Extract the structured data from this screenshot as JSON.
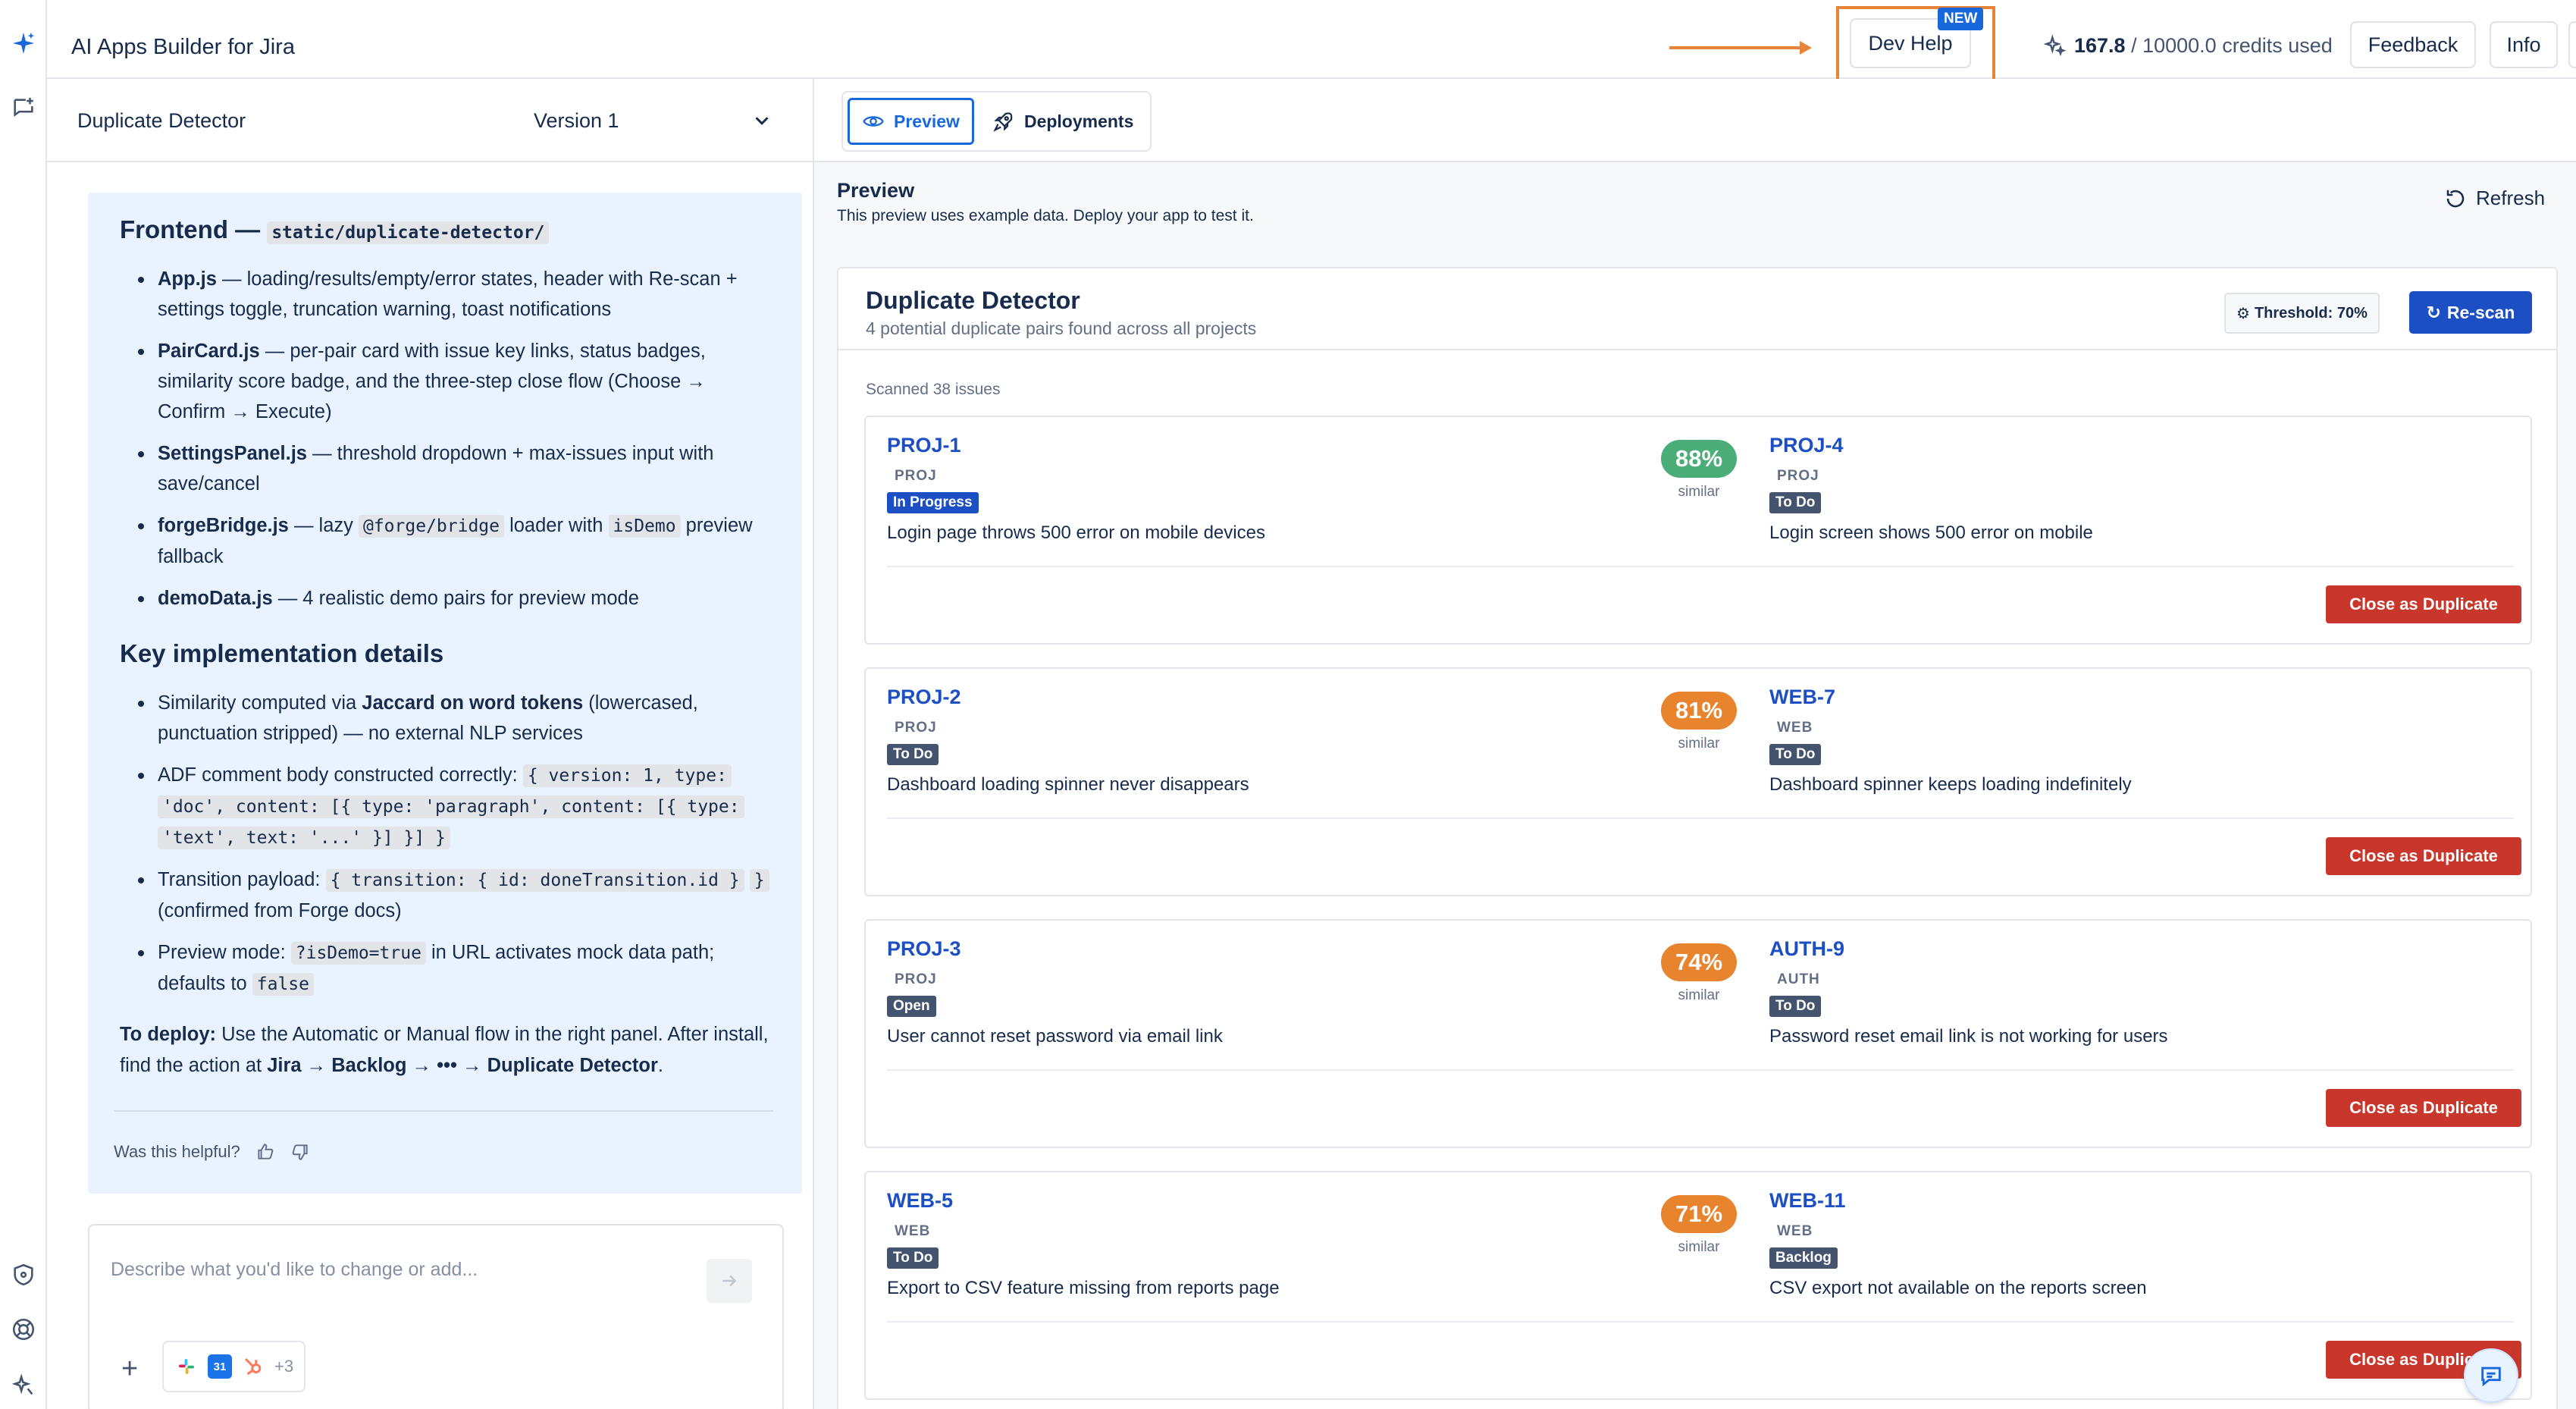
{
  "app": {
    "title": "AI Apps Builder for Jira"
  },
  "topbar": {
    "dev_help": "Dev Help",
    "new_badge": "NEW",
    "credits_used": "167.8",
    "credits_rest": "/ 10000.0 credits used",
    "feedback": "Feedback",
    "info": "Info",
    "more": "•••",
    "accent_color": "#e8833a"
  },
  "rail": {
    "icons": [
      "sparkle-icon",
      "chat-add-icon",
      "shield-icon",
      "help-circle-icon",
      "sparkle-settings-icon"
    ]
  },
  "left": {
    "app_name": "Duplicate Detector",
    "version": "Version 1",
    "frontend_heading": "Frontend —",
    "frontend_path": "static/duplicate-detector/",
    "frontend_items": [
      {
        "name": "App.js",
        "text": " — loading/results/empty/error states, header with Re-scan + settings toggle, truncation warning, toast notifications"
      },
      {
        "name": "PairCard.js",
        "text": " — per-pair card with issue key links, status badges, similarity score badge, and the three-step close flow (Choose → Confirm → Execute)"
      },
      {
        "name": "SettingsPanel.js",
        "text": " — threshold dropdown + max-issues input with save/cancel"
      },
      {
        "name": "forgeBridge.js",
        "text_a": " — lazy ",
        "code_a": "@forge/bridge",
        "text_b": " loader with ",
        "code_b": "isDemo",
        "text_c": " preview fallback"
      },
      {
        "name": "demoData.js",
        "text": " — 4 realistic demo pairs for preview mode"
      }
    ],
    "impl_heading": "Key implementation details",
    "impl_1_a": "Similarity computed via ",
    "impl_1_b": "Jaccard on word tokens",
    "impl_1_c": " (lowercased, punctuation stripped) — no external NLP services",
    "impl_2_a": "ADF comment body constructed correctly: ",
    "impl_2_code_1": "{ version: 1, type:",
    "impl_2_code_2": "'doc', content: [{ type: 'paragraph', content: [{ type:",
    "impl_2_code_3": "'text', text: '...' }] }] }",
    "impl_3_a": "Transition payload: ",
    "impl_3_code_1": "{ transition: { id: doneTransition.id }",
    "impl_3_code_2": "}",
    "impl_3_b": " (confirmed from Forge docs)",
    "impl_4_a": "Preview mode: ",
    "impl_4_code": "?isDemo=true",
    "impl_4_b": " in URL activates mock data path; defaults to ",
    "impl_4_code_2": "false",
    "deploy_label": "To deploy:",
    "deploy_text_a": " Use the Automatic or Manual flow in the right panel. After install, find the action at ",
    "deploy_path": "Jira → Backlog → ••• → Duplicate Detector",
    "deploy_end": ".",
    "helpful": "Was this helpful?",
    "prompt_placeholder": "Describe what you'd like to change or add...",
    "integrations_more": "+3"
  },
  "preview": {
    "tab_preview": "Preview",
    "tab_deployments": "Deployments",
    "title": "Preview",
    "subtitle": "This preview uses example data. Deploy your app to test it.",
    "refresh": "Refresh",
    "card_title": "Duplicate Detector",
    "card_sub": "4 potential duplicate pairs found across all projects",
    "threshold": "Threshold: 70%",
    "rescan": "Re-scan",
    "scanned": "Scanned 38 issues",
    "similar_label": "similar",
    "close_label": "Close as Duplicate",
    "pairs": [
      {
        "a_key": "PROJ-1",
        "a_proj": "PROJ",
        "a_status": "In Progress",
        "a_summary": "Login page throws 500 error on mobile devices",
        "score": "88%",
        "score_color": "#4bae79",
        "b_key": "PROJ-4",
        "b_proj": "PROJ",
        "b_status": "To Do",
        "b_summary": "Login screen shows 500 error on mobile"
      },
      {
        "a_key": "PROJ-2",
        "a_proj": "PROJ",
        "a_status": "To Do",
        "a_summary": "Dashboard loading spinner never disappears",
        "score": "81%",
        "score_color": "#e8832e",
        "b_key": "WEB-7",
        "b_proj": "WEB",
        "b_status": "To Do",
        "b_summary": "Dashboard spinner keeps loading indefinitely"
      },
      {
        "a_key": "PROJ-3",
        "a_proj": "PROJ",
        "a_status": "Open",
        "a_summary": "User cannot reset password via email link",
        "score": "74%",
        "score_color": "#e8832e",
        "b_key": "AUTH-9",
        "b_proj": "AUTH",
        "b_status": "To Do",
        "b_summary": "Password reset email link is not working for users"
      },
      {
        "a_key": "WEB-5",
        "a_proj": "WEB",
        "a_status": "To Do",
        "a_summary": "Export to CSV feature missing from reports page",
        "score": "71%",
        "score_color": "#e8832e",
        "b_key": "WEB-11",
        "b_proj": "WEB",
        "b_status": "Backlog",
        "b_summary": "CSV export not available on the reports screen"
      }
    ]
  }
}
